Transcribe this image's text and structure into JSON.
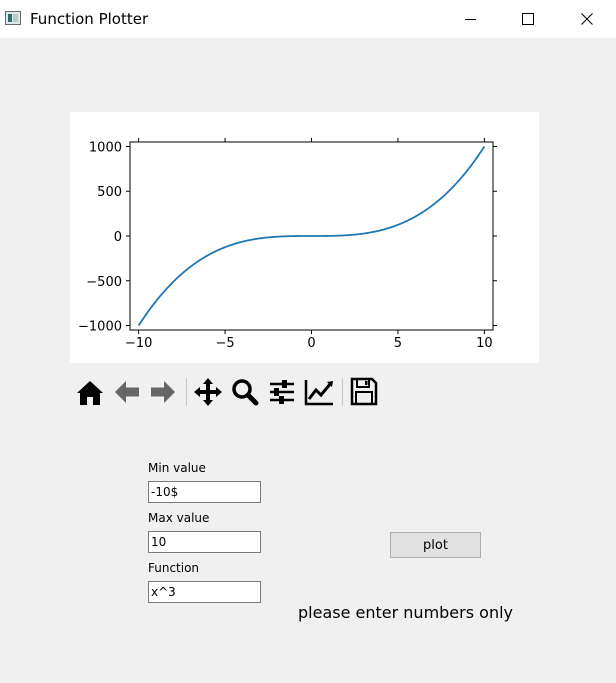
{
  "window": {
    "title": "Function Plotter",
    "controls": [
      "minimize",
      "maximize",
      "close"
    ]
  },
  "plot": {
    "chart_data": {
      "type": "line",
      "function": "x^3",
      "x_range": [
        -10,
        10
      ],
      "xlim": [
        -10.5,
        10.5
      ],
      "ylim": [
        -1050,
        1050
      ],
      "x_ticks": [
        -10,
        -5,
        0,
        5,
        10
      ],
      "x_tick_labels": [
        "−10",
        "−5",
        "0",
        "5",
        "10"
      ],
      "y_ticks": [
        1000,
        500,
        0,
        -500,
        -1000
      ],
      "y_tick_labels": [
        "1000",
        "500",
        "0",
        "−500",
        "−1000"
      ],
      "series": [
        {
          "color": "#1f77b4",
          "x": [
            -10,
            -9,
            -8,
            -7,
            -6,
            -5,
            -4,
            -3,
            -2,
            -1,
            0,
            1,
            2,
            3,
            4,
            5,
            6,
            7,
            8,
            9,
            10
          ],
          "y": [
            -1000,
            -729,
            -512,
            -343,
            -216,
            -125,
            -64,
            -27,
            -8,
            -1,
            0,
            1,
            8,
            27,
            64,
            125,
            216,
            343,
            512,
            729,
            1000
          ]
        }
      ],
      "grid": false,
      "legend": false
    }
  },
  "toolbar": {
    "buttons": [
      {
        "icon": "home-icon"
      },
      {
        "icon": "back-arrow-icon"
      },
      {
        "icon": "forward-arrow-icon"
      },
      {
        "icon": "pan-icon"
      },
      {
        "icon": "zoom-icon"
      },
      {
        "icon": "subplots-config-icon"
      },
      {
        "icon": "edit-axes-icon"
      },
      {
        "icon": "save-icon"
      }
    ]
  },
  "form": {
    "min_label": "Min value",
    "min_value": "-10$",
    "max_label": "Max value",
    "max_value": "10",
    "function_label": "Function",
    "function_value": "x^3",
    "plot_button": "plot",
    "status_message": "please enter numbers only"
  }
}
